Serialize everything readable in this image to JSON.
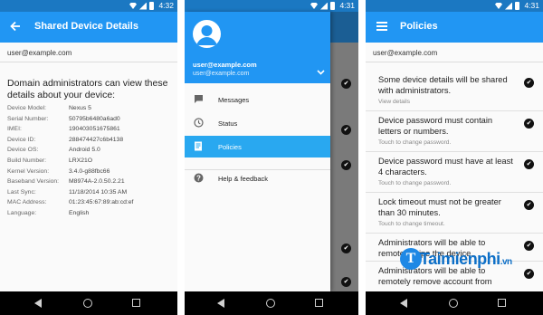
{
  "status_bar": {
    "time": "4:32",
    "time_mid": "4:31",
    "time_right": "4:31"
  },
  "screen1": {
    "title": "Shared Device Details",
    "email": "user@example.com",
    "intro": "Domain administrators can view these details about your device:",
    "details": [
      {
        "label": "Device Model:",
        "value": "Nexus 5"
      },
      {
        "label": "Serial Number:",
        "value": "50795b6480a6ad0"
      },
      {
        "label": "IMEI:",
        "value": "190403051675861"
      },
      {
        "label": "Device ID:",
        "value": "288474427c6b4138"
      },
      {
        "label": "Device OS:",
        "value": "Android 5.0"
      },
      {
        "label": "Build Number:",
        "value": "LRX21O"
      },
      {
        "label": "Kernel Version:",
        "value": "3.4.0-g88fbc66"
      },
      {
        "label": "Baseband Version:",
        "value": "M8974A-2.0.50.2.21"
      },
      {
        "label": "Last Sync:",
        "value": "11/18/2014 10:35 AM"
      },
      {
        "label": "MAC Address:",
        "value": "01:23:45:67:89:ab:cd:ef"
      },
      {
        "label": "Language:",
        "value": "English"
      }
    ]
  },
  "screen2": {
    "email_primary": "user@example.com",
    "email_secondary": "user@example.com",
    "items": [
      {
        "label": "Messages",
        "icon": "message-icon"
      },
      {
        "label": "Status",
        "icon": "clock-icon"
      },
      {
        "label": "Policies",
        "icon": "document-icon",
        "active": true
      },
      {
        "label": "Help & feedback",
        "icon": "help-icon"
      }
    ]
  },
  "screen3": {
    "title": "Policies",
    "email": "user@example.com",
    "policies": [
      {
        "text": "Some device details will be shared with administrators.",
        "sub": "View details"
      },
      {
        "text": "Device password must contain letters or numbers.",
        "sub": "Touch to change password."
      },
      {
        "text": "Device password must have at least 4 characters.",
        "sub": "Touch to change password."
      },
      {
        "text": "Lock timeout must not be greater than 30 minutes.",
        "sub": "Touch to change timeout."
      },
      {
        "text": "Administrators will be able to remotely wipe the device.",
        "sub": ""
      },
      {
        "text": "Administrators will be able to remotely remove account from",
        "sub": ""
      }
    ]
  },
  "watermark": {
    "brand": "Taimienphi",
    "suffix": ".vn"
  },
  "colors": {
    "appbar": "#2196f3",
    "statusbar": "#1b78c2",
    "active": "#29a8f0"
  }
}
